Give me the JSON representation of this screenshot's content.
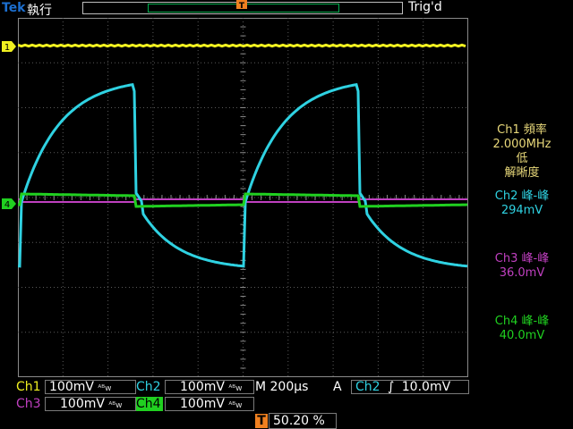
{
  "topbar": {
    "brand": "Tek",
    "mode": "執行",
    "trigger_status": "Trig'd"
  },
  "markers": {
    "ch1": "1",
    "ch4": "4",
    "trigger_pos": "T"
  },
  "side_panel": {
    "ch1_label": "Ch1 頻率",
    "ch1_value": "2.000MHz",
    "ch1_note_1": "低",
    "ch1_note_2": "解晰度",
    "ch2_label": "Ch2 峰-峰",
    "ch2_value": "294mV",
    "ch3_label": "Ch3 峰-峰",
    "ch3_value": "36.0mV",
    "ch4_label": "Ch4 峰-峰",
    "ch4_value": "40.0mV"
  },
  "bottom": {
    "ch1_label": "Ch1",
    "ch1_scale": "100mV",
    "ch2_label": "Ch2",
    "ch2_scale": "100mV",
    "ch3_label": "Ch3",
    "ch3_scale": "100mV",
    "ch4_label": "Ch4",
    "ch4_scale": "100mV",
    "bw_symbol": "ᴬᴮ𝗐",
    "timebase": "M 200µs",
    "acq": "A",
    "trig_source": "Ch2",
    "trig_slope": "∫",
    "trig_level": "10.0mV",
    "trig_pos_icon": "T",
    "trig_pos_value": "50.20 %"
  },
  "colors": {
    "ch1": "#f0f020",
    "ch2": "#2fd2e2",
    "ch3": "#c040c0",
    "ch4": "#20d020",
    "trigger": "#f08020",
    "brand": "#1c6fd0"
  }
}
